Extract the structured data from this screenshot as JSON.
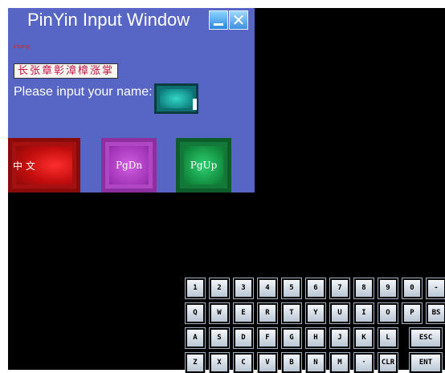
{
  "window": {
    "title": "PinYin Input Window",
    "pinyin_text": "zhang",
    "candidates": "长张章彰漳樟涨掌",
    "prompt": "Please input your name:",
    "buttons": {
      "chinese": "中 文",
      "page_down": "PgDn",
      "page_up": "PgUp"
    }
  },
  "keyboard": {
    "row1": [
      "1",
      "2",
      "3",
      "4",
      "5",
      "6",
      "7",
      "8",
      "9",
      "0",
      "-"
    ],
    "row2": [
      "Q",
      "W",
      "E",
      "R",
      "T",
      "Y",
      "U",
      "I",
      "O",
      "P",
      "BS"
    ],
    "row3": [
      "A",
      "S",
      "D",
      "F",
      "G",
      "H",
      "J",
      "K",
      "L",
      "ESC"
    ],
    "row4": [
      "Z",
      "X",
      "C",
      "V",
      "B",
      "N",
      "M",
      "·",
      "CLR",
      "ENT"
    ]
  },
  "colors": {
    "window_bg": "#5766c4",
    "zh_button": "#c10d0d",
    "pgdn_button": "#a335b8",
    "pgup_button": "#128a3e",
    "input_box": "#138f8c"
  }
}
